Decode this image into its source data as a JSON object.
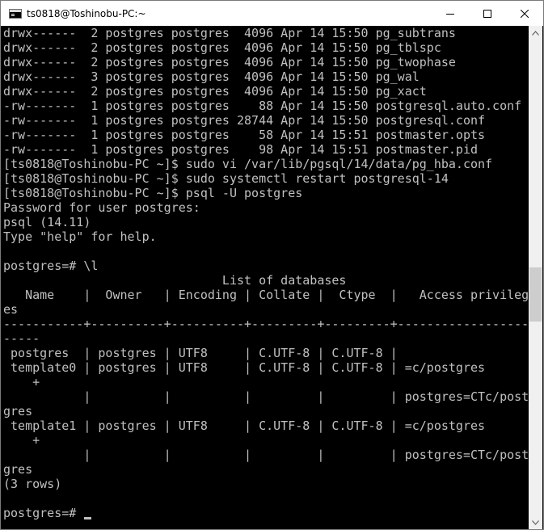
{
  "window": {
    "title": "ts0818@Toshinobu-PC:~",
    "icon": "console-icon",
    "controls": {
      "minimize": "minimize-icon",
      "maximize": "maximize-icon",
      "close": "close-icon"
    }
  },
  "terminal": {
    "lines": [
      "drwx------  2 postgres postgres  4096 Apr 14 15:50 pg_subtrans",
      "drwx------  2 postgres postgres  4096 Apr 14 15:50 pg_tblspc",
      "drwx------  2 postgres postgres  4096 Apr 14 15:50 pg_twophase",
      "drwx------  3 postgres postgres  4096 Apr 14 15:50 pg_wal",
      "drwx------  2 postgres postgres  4096 Apr 14 15:50 pg_xact",
      "-rw-------  1 postgres postgres    88 Apr 14 15:50 postgresql.auto.conf",
      "-rw-------  1 postgres postgres 28744 Apr 14 15:50 postgresql.conf",
      "-rw-------  1 postgres postgres    58 Apr 14 15:51 postmaster.opts",
      "-rw-------  1 postgres postgres    98 Apr 14 15:51 postmaster.pid",
      "[ts0818@Toshinobu-PC ~]$ sudo vi /var/lib/pgsql/14/data/pg_hba.conf",
      "[ts0818@Toshinobu-PC ~]$ sudo systemctl restart postgresql-14",
      "[ts0818@Toshinobu-PC ~]$ psql -U postgres",
      "Password for user postgres:",
      "psql (14.11)",
      "Type \"help\" for help.",
      "",
      "postgres=# \\l",
      "                              List of databases",
      "   Name    |  Owner   | Encoding | Collate |  Ctype  |   Access privileg",
      "es",
      "-----------+----------+----------+---------+---------+------------------",
      "-----",
      " postgres  | postgres | UTF8     | C.UTF-8 | C.UTF-8 |",
      " template0 | postgres | UTF8     | C.UTF-8 | C.UTF-8 | =c/postgres",
      "    +",
      "           |          |          |         |         | postgres=CTc/post",
      "gres",
      " template1 | postgres | UTF8     | C.UTF-8 | C.UTF-8 | =c/postgres",
      "    +",
      "           |          |          |         |         | postgres=CTc/post",
      "gres",
      "(3 rows)",
      "",
      "postgres=# "
    ]
  },
  "scrollbar": {
    "position_fraction": 0.54,
    "up": "scroll-up-arrow-icon",
    "down": "scroll-down-arrow-icon"
  }
}
